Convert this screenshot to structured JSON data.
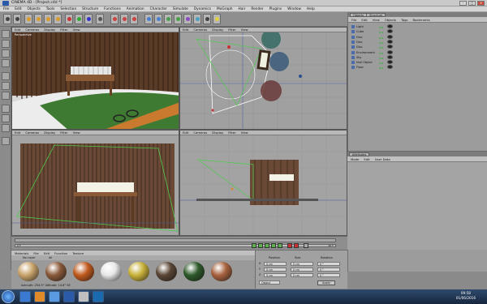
{
  "window": {
    "title": "CINEMA 4D - [Project.c4d *]"
  },
  "menubar": [
    "File",
    "Edit",
    "Objects",
    "Tools",
    "Selection",
    "Structure",
    "Functions",
    "Animation",
    "Character",
    "Simulate",
    "Dynamics",
    "MoGraph",
    "Hair",
    "Render",
    "Plugins",
    "Window",
    "Help"
  ],
  "viewports": [
    {
      "label": "Perspective",
      "menu": [
        "Edit",
        "Cameras",
        "Display",
        "Filter",
        "View"
      ]
    },
    {
      "label": "",
      "menu": [
        "Edit",
        "Cameras",
        "Display",
        "Filter",
        "View"
      ]
    },
    {
      "label": "",
      "menu": [
        "Edit",
        "Cameras",
        "Display",
        "Filter",
        "View"
      ]
    },
    {
      "label": "",
      "menu": [
        "Edit",
        "Cameras",
        "Display",
        "Filter",
        "View"
      ]
    }
  ],
  "object_manager": {
    "tabs": [
      "Objects",
      "Structure"
    ],
    "menu": [
      "File",
      "Edit",
      "View",
      "Objects",
      "Tags",
      "Bookmarks"
    ],
    "rows": [
      {
        "name": "Light"
      },
      {
        "name": "Cube"
      },
      {
        "name": "Disc"
      },
      {
        "name": "Disc"
      },
      {
        "name": "Disc"
      },
      {
        "name": "Environment"
      },
      {
        "name": "Sky"
      },
      {
        "name": "Null Object"
      },
      {
        "name": "Floor"
      }
    ]
  },
  "attributes": {
    "tab": "Attributes",
    "menu": [
      "Mode",
      "Edit",
      "User Data"
    ]
  },
  "timeline": {
    "current_frame": "0 F",
    "end_frame": "90 F"
  },
  "material_manager": {
    "title": "Materials",
    "menu": [
      "File",
      "Edit",
      "Function",
      "Texture"
    ],
    "filters": [
      "No Layer",
      "All"
    ],
    "swatches": [
      {
        "name": "Sky",
        "color": "#c9a46b"
      },
      {
        "name": "Mat",
        "color": "#8a5a3a"
      },
      {
        "name": "Mat",
        "color": "#c05a1e"
      },
      {
        "name": "Mat",
        "color": "#e8e8e8"
      },
      {
        "name": "Mat",
        "color": "#c9b23a"
      },
      {
        "name": "Mat",
        "color": "#5a4636"
      },
      {
        "name": "Mat",
        "color": "#2e5a2a"
      },
      {
        "name": "Mat",
        "color": "#a8623f"
      }
    ],
    "status": "Azimuth: 254.5°   Altitude: 14.8°   SE"
  },
  "coordinates": {
    "headers": [
      "Position",
      "Size",
      "Rotation"
    ],
    "rows": [
      {
        "axis": "X",
        "pos": "0 cm",
        "size": "0 cm",
        "rot": "0 °"
      },
      {
        "axis": "Y",
        "pos": "0 cm",
        "size": "0 cm",
        "rot": "0 °"
      },
      {
        "axis": "Z",
        "pos": "0 cm",
        "size": "0 cm",
        "rot": "0 °"
      }
    ],
    "mode": "Object",
    "apply": "Apply"
  },
  "taskbar": {
    "time": "09:58",
    "date": "01/06/2016"
  },
  "colors": {
    "accent": "#5eb14e",
    "taskbar": "#1f3453",
    "viewport_bg": "#9d9d9d"
  }
}
